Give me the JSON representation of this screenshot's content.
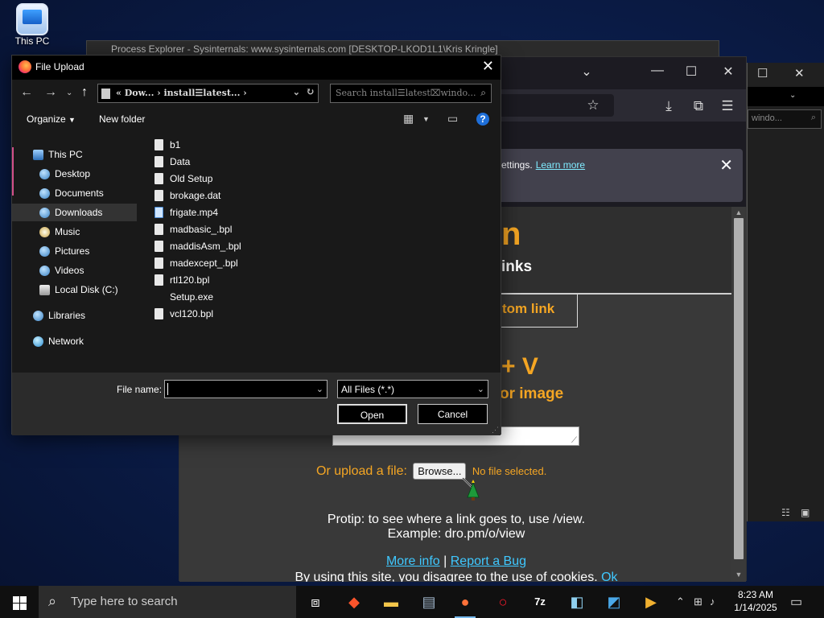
{
  "desktop": {
    "icon_label": "This PC"
  },
  "background_windows": {
    "process_explorer_title": "Process Explorer - Sysinternals: www.sysinternals.com [DESKTOP-LKOD1L1\\Kris Kringle]",
    "right_window_search": "windo...",
    "right_window_help": "?"
  },
  "firefox": {
    "notice_text": "ettings.",
    "notice_link": "Learn more",
    "page": {
      "logo_fragment": "n",
      "links_fragment": "inks",
      "tab_fragment": "tom link",
      "paste_fragment": "+ V",
      "image_fragment": "or image",
      "upload_label": "Or upload a file:",
      "browse_label": "Browse...",
      "no_file": "No file selected.",
      "protip_line1": "Protip: to see where a link goes to, use /view.",
      "protip_line2": "Example: dro.pm/o/view",
      "more_info": "More info",
      "separator": "|",
      "report_bug": "Report a Bug",
      "cookie_text": "By using this site, you disagree to the use of cookies.",
      "cookie_ok": "Ok"
    }
  },
  "dialog": {
    "title": "File Upload",
    "address": "«  Dow...  ›  install☰latest...  ›",
    "search_placeholder": "Search install☰latest⌧windo...",
    "organize": "Organize",
    "new_folder": "New folder",
    "nav_items": [
      {
        "label": "This PC"
      },
      {
        "label": "Desktop"
      },
      {
        "label": "Documents"
      },
      {
        "label": "Downloads"
      },
      {
        "label": "Music"
      },
      {
        "label": "Pictures"
      },
      {
        "label": "Videos"
      },
      {
        "label": "Local Disk (C:)"
      },
      {
        "label": "Libraries"
      },
      {
        "label": "Network"
      }
    ],
    "files": [
      {
        "name": "b1",
        "kind": "file"
      },
      {
        "name": "Data",
        "kind": "file"
      },
      {
        "name": "Old Setup",
        "kind": "file"
      },
      {
        "name": "brokage.dat",
        "kind": "file"
      },
      {
        "name": "frigate.mp4",
        "kind": "video"
      },
      {
        "name": "madbasic_.bpl",
        "kind": "file"
      },
      {
        "name": "maddisAsm_.bpl",
        "kind": "file"
      },
      {
        "name": "madexcept_.bpl",
        "kind": "file"
      },
      {
        "name": "rtl120.bpl",
        "kind": "file"
      },
      {
        "name": "Setup.exe",
        "kind": "exe"
      },
      {
        "name": "vcl120.bpl",
        "kind": "file"
      }
    ],
    "file_name_label": "File name:",
    "file_name_value": "",
    "filter_value": "All Files (*.*)",
    "open_label": "Open",
    "cancel_label": "Cancel"
  },
  "taskbar": {
    "search_placeholder": "Type here to search",
    "time": "8:23 AM",
    "date": "1/14/2025",
    "apps": [
      "task-view",
      "brave",
      "file-explorer",
      "network-app",
      "firefox",
      "opera",
      "7zip",
      "notepad",
      "magnifier",
      "media-player"
    ]
  }
}
